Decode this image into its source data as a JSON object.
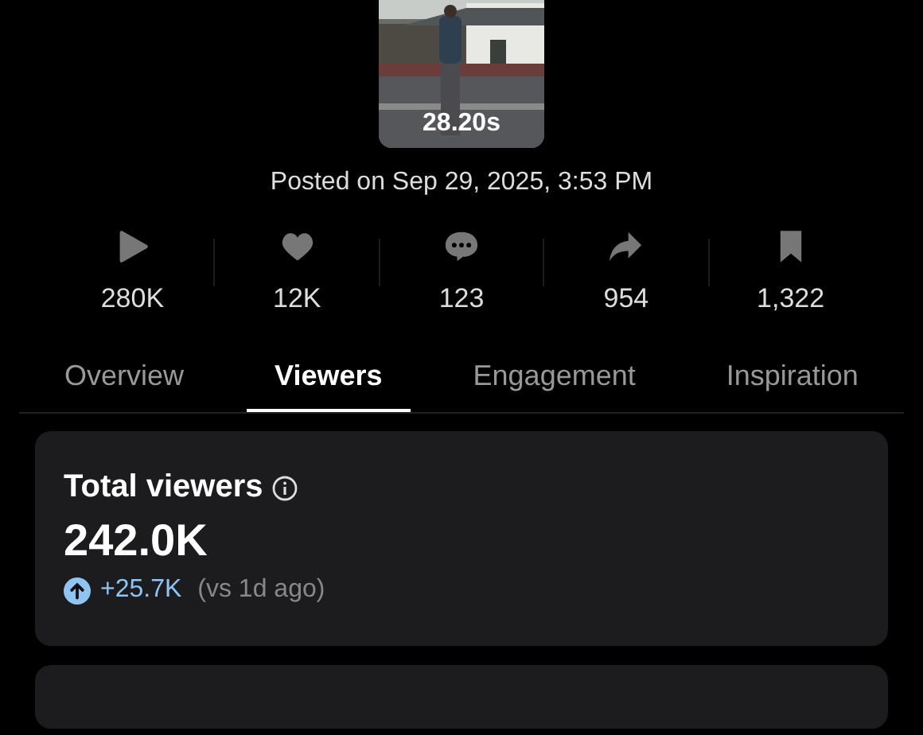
{
  "video": {
    "kind": "picture",
    "duration": "28.20s"
  },
  "posted": "Posted on Sep 29, 2025, 3:53 PM",
  "stats": [
    {
      "kind": "plays",
      "value": "280K"
    },
    {
      "kind": "likes",
      "value": "12K"
    },
    {
      "kind": "comments",
      "value": "123"
    },
    {
      "kind": "shares",
      "value": "954"
    },
    {
      "kind": "saves",
      "value": "1,322"
    }
  ],
  "tabs": [
    {
      "label": "Overview",
      "selected": false
    },
    {
      "label": "Viewers",
      "selected": true
    },
    {
      "label": "Engagement",
      "selected": false
    },
    {
      "label": "Inspiration",
      "selected": false
    }
  ],
  "total_viewers": {
    "title": "Total viewers",
    "value": "242.0K",
    "change": "+25.7K",
    "comparison": "(vs 1d ago)"
  }
}
